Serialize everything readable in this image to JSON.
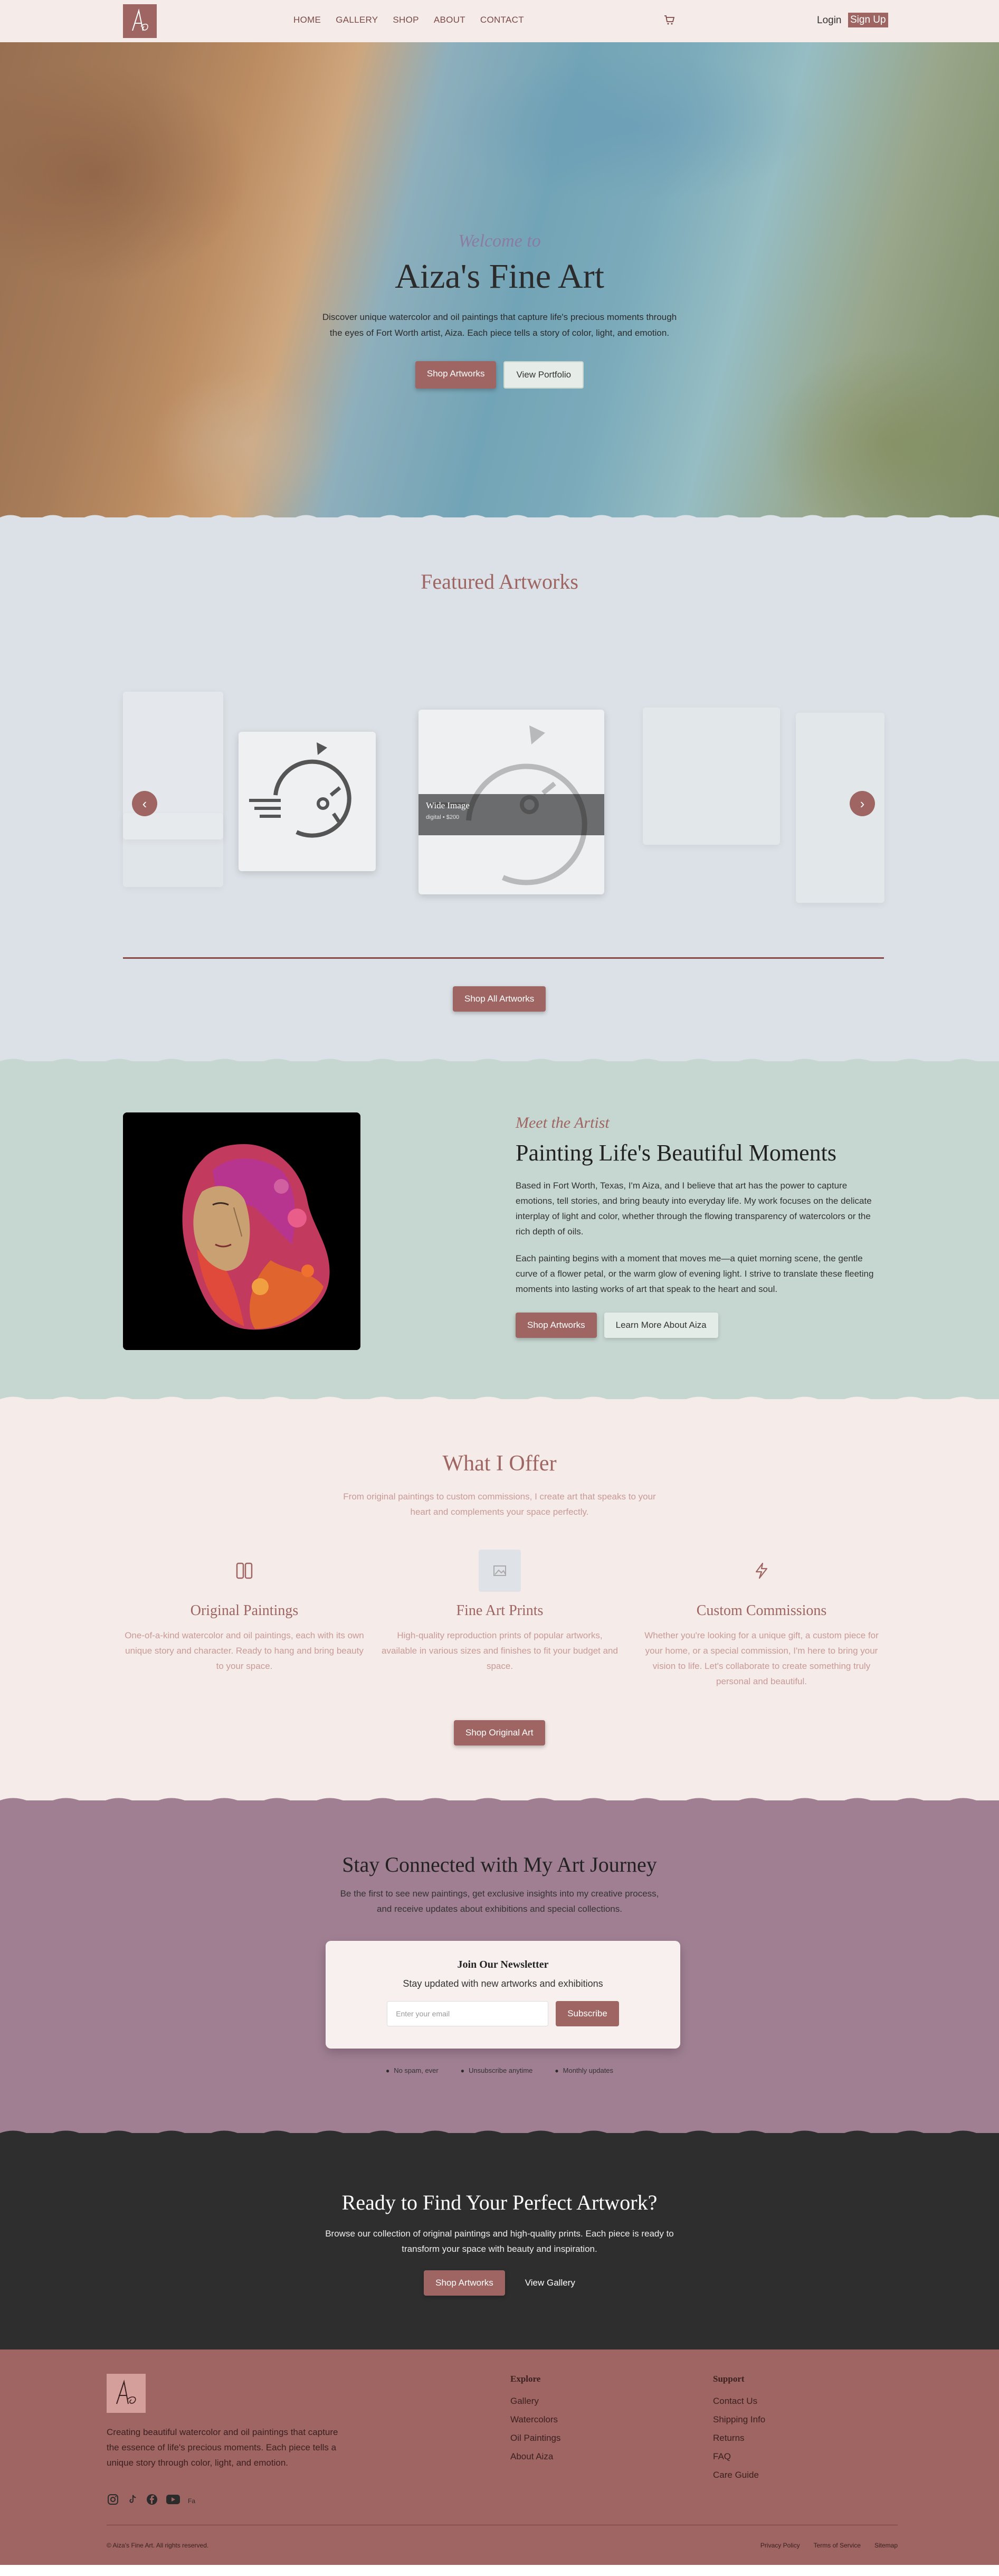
{
  "colors": {
    "accent": "#9e6562",
    "featured_bg": "#dbe1e6",
    "about_bg": "#c6d6d0",
    "offer_bg": "#f5ebe8",
    "news_bg": "#a07f93",
    "cta_bg": "#2e2e2e"
  },
  "nav": {
    "logo_text": "Aiza",
    "links": [
      "HOME",
      "GALLERY",
      "SHOP",
      "ABOUT",
      "CONTACT"
    ],
    "cart_icon": "cart-icon",
    "login": "Login",
    "signup": "Sign Up"
  },
  "hero": {
    "welcome": "Welcome to",
    "title": "Aiza's Fine Art",
    "description": "Discover unique watercolor and oil paintings that capture life's precious moments through the eyes of Fort Worth artist, Aiza. Each piece tells a story of color, light, and emotion.",
    "primary_button": "Shop Artworks",
    "secondary_button": "View Portfolio"
  },
  "featured": {
    "title": "Featured Artworks",
    "card_title": "Wide Image",
    "card_meta": "digital • $200",
    "button": "Shop All Artworks"
  },
  "about": {
    "kicker": "Meet the Artist",
    "title": "Painting Life's Beautiful Moments",
    "p1": "Based in Fort Worth, Texas, I'm Aiza, and I believe that art has the power to capture emotions, tell stories, and bring beauty into everyday life. My work focuses on the delicate interplay of light and color, whether through the flowing transparency of watercolors or the rich depth of oils.",
    "p2": "Each painting begins with a moment that moves me—a quiet morning scene, the gentle curve of a flower petal, or the warm glow of evening light. I strive to translate these fleeting moments into lasting works of art that speak to the heart and soul.",
    "primary_button": "Shop Artworks",
    "secondary_button": "Learn More About Aiza"
  },
  "offer": {
    "title": "What I Offer",
    "subtitle_1": "From original paintings to custom commissions, I create art that speaks to your",
    "subtitle_2": "heart and complements your space perfectly.",
    "items": [
      {
        "title": "Original Paintings",
        "text": "One-of-a-kind watercolor and oil paintings, each with its own unique story and character. Ready to hang and bring beauty to your space."
      },
      {
        "title": "Fine Art Prints",
        "text": "High-quality reproduction prints of popular artworks, available in various sizes and finishes to fit your budget and space."
      },
      {
        "title": "Custom Commissions",
        "text": "Whether you're looking for a unique gift, a custom piece for your home, or a special commission, I'm here to bring your vision to life. Let's collaborate to create something truly personal and beautiful."
      }
    ],
    "button": "Shop Original Art"
  },
  "newsletter": {
    "title": "Stay Connected with My Art Journey",
    "subtitle_1": "Be the first to see new paintings, get exclusive insights into my creative process,",
    "subtitle_2": "and receive updates about exhibitions and special collections.",
    "card_title": "Join Our Newsletter",
    "card_subtitle": "Stay updated with new artworks and exhibitions",
    "input_placeholder": "Enter your email",
    "button": "Subscribe",
    "features": [
      "No spam, ever",
      "Unsubscribe anytime",
      "Monthly updates"
    ]
  },
  "cta": {
    "title": "Ready to Find Your Perfect Artwork?",
    "text_1": "Browse our collection of original paintings and high-quality prints. Each piece is ready to",
    "text_2": "transform your space with beauty and inspiration.",
    "primary_button": "Shop Artworks",
    "secondary_button": "View Gallery"
  },
  "footer": {
    "description": "Creating beautiful watercolor and oil paintings that capture the essence of life's precious moments. Each piece tells a unique story through color, light, and emotion.",
    "explore_title": "Explore",
    "explore": [
      "Gallery",
      "Watercolors",
      "Oil Paintings",
      "About Aiza"
    ],
    "support_title": "Support",
    "support": [
      "Contact Us",
      "Shipping Info",
      "Returns",
      "FAQ",
      "Care Guide"
    ],
    "copyright": "© Aiza's Fine Art. All rights reserved.",
    "legal": [
      "Privacy Policy",
      "Terms of Service",
      "Sitemap"
    ],
    "social_icons": [
      "instagram-icon",
      "tiktok-icon",
      "facebook-icon",
      "youtube-icon",
      "fa-icon"
    ],
    "social_fa_label": "Fa"
  }
}
